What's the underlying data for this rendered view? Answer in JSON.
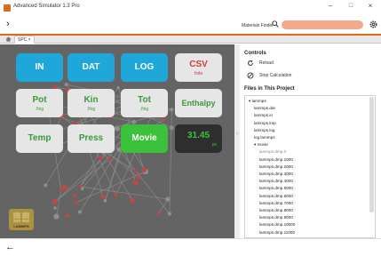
{
  "window": {
    "title": "Advanced Simulator 1.3 Pro",
    "minimize": "–",
    "maximize": "□",
    "close": "×"
  },
  "toolbar": {
    "forward_arrow": "›",
    "search_label": "Materials Finder",
    "search_value": "",
    "gear_icon": "gear-icon",
    "accent_color": "#e06a1a",
    "search_field_color": "#f4a98a"
  },
  "tabs": [
    {
      "label": "SPC ×"
    }
  ],
  "buttons": {
    "in": "IN",
    "dat": "DAT",
    "log": "LOG",
    "csv": {
      "main": "CSV",
      "sub": "hide"
    },
    "pot": {
      "main": "Pot",
      "sub": ".fing"
    },
    "kin": {
      "main": "Kin",
      "sub": ".fing"
    },
    "tot": {
      "main": "Tot",
      "sub": ".fing"
    },
    "enthalpy": "Enthalpy",
    "temp": "Temp",
    "press": "Press",
    "movie": "Movie",
    "readout": {
      "value": "31.45",
      "unit": "ps"
    }
  },
  "logo": {
    "text": "LAMMPS"
  },
  "panel": {
    "controls_heading": "Controls",
    "reload_label": "Reload",
    "stop_label": "Stop Calculation",
    "files_heading": "Files in This Project",
    "files": [
      {
        "label": "▾ lammps",
        "grey": false,
        "indent": 0
      },
      {
        "label": "lammps.dat",
        "grey": false,
        "indent": 1
      },
      {
        "label": "lammps.in",
        "grey": false,
        "indent": 1
      },
      {
        "label": "lammps.lmp",
        "grey": false,
        "indent": 1
      },
      {
        "label": "lammps.log",
        "grey": false,
        "indent": 1
      },
      {
        "label": "log.lammps",
        "grey": false,
        "indent": 1
      },
      {
        "label": "▾ movie",
        "grey": false,
        "indent": 1
      },
      {
        "label": "lammps.dmp.0",
        "grey": true,
        "indent": 2
      },
      {
        "label": "lammps.dmp.1000",
        "grey": false,
        "indent": 2
      },
      {
        "label": "lammps.dmp.2000",
        "grey": false,
        "indent": 2
      },
      {
        "label": "lammps.dmp.3000",
        "grey": false,
        "indent": 2
      },
      {
        "label": "lammps.dmp.4000",
        "grey": false,
        "indent": 2
      },
      {
        "label": "lammps.dmp.5000",
        "grey": false,
        "indent": 2
      },
      {
        "label": "lammps.dmp.6000",
        "grey": false,
        "indent": 2
      },
      {
        "label": "lammps.dmp.7000",
        "grey": false,
        "indent": 2
      },
      {
        "label": "lammps.dmp.8000",
        "grey": false,
        "indent": 2
      },
      {
        "label": "lammps.dmp.9000",
        "grey": false,
        "indent": 2
      },
      {
        "label": "lammps.dmp.10000",
        "grey": false,
        "indent": 2
      },
      {
        "label": "lammps.dmp.11000",
        "grey": false,
        "indent": 2
      }
    ]
  },
  "bottombar": {
    "back_arrow": "←"
  }
}
